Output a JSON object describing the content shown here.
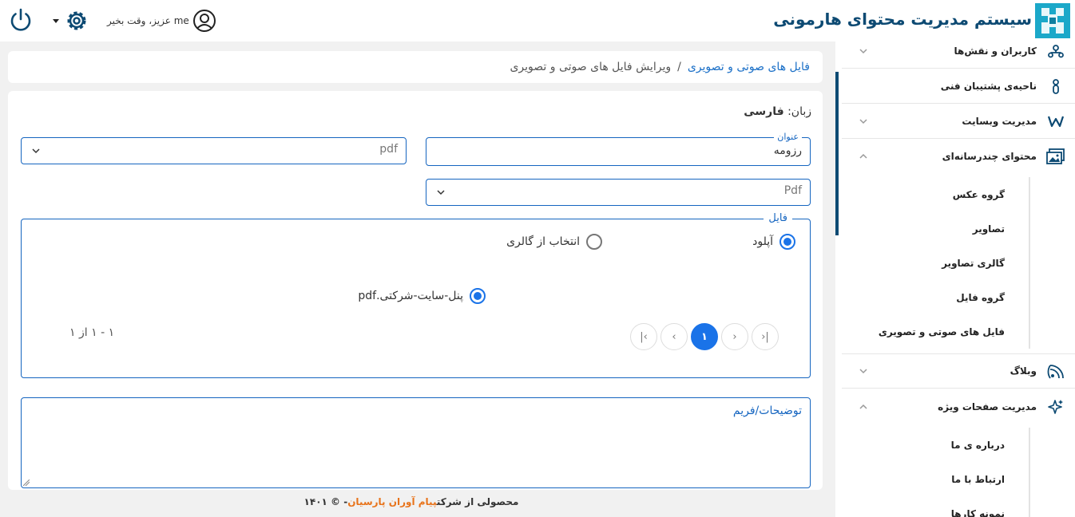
{
  "header": {
    "app_title": "سیستم مدیریت محتوای هارمونی",
    "greeting": "me عزیز، وقت بخیر"
  },
  "sidebar": {
    "items": [
      {
        "label": "کاربران و نقش‌ها",
        "icon": "users-roles-icon"
      },
      {
        "label": "ناحیه‌ی پشتیبان فنی",
        "icon": "support-icon"
      },
      {
        "label": "مدیریت وبسایت",
        "icon": "website-icon"
      },
      {
        "label": "محتوای چندرسانه‌ای",
        "icon": "multimedia-icon"
      },
      {
        "label": "وبلاگ",
        "icon": "blog-icon"
      },
      {
        "label": "مدیریت صفحات ویژه",
        "icon": "sparkle-icon"
      }
    ],
    "multimedia_sub": [
      "گروه عکس",
      "تصاویر",
      "گالری تصاویر",
      "گروه فایل",
      "فایل های صوتی و تصویری"
    ],
    "special_sub": [
      "درباره ی ما",
      "ارتباط با ما",
      "نمونه کارها"
    ]
  },
  "breadcrumb": {
    "link": "فایل های صوتی و تصویری",
    "separator": "/",
    "current": "ویرایش فایل های صوتی و تصویری"
  },
  "form": {
    "language_label": "زبان:",
    "language_value": "فارسی",
    "title_legend": "عنوان",
    "title_value": "رزومه",
    "type_select": "pdf",
    "type_select2": "Pdf",
    "file_legend": "فایل",
    "upload_label": "آپلود",
    "gallery_label": "انتخاب از گالری",
    "file_name": "پنل-سایت-شرکتی.pdf",
    "page_current": "۱",
    "page_info": "۱ - ۱ از ۱",
    "description_placeholder": "توضیحات/فریم"
  },
  "footer": {
    "prefix": "محصولی از شرکت",
    "brand": "پیام آوران پارسیان",
    "suffix": "- © ۱۴۰۱"
  },
  "colors": {
    "primary": "#1565c0",
    "accent": "#1a73e8",
    "title": "#0d4a73",
    "brand_orange": "#e8731a"
  }
}
